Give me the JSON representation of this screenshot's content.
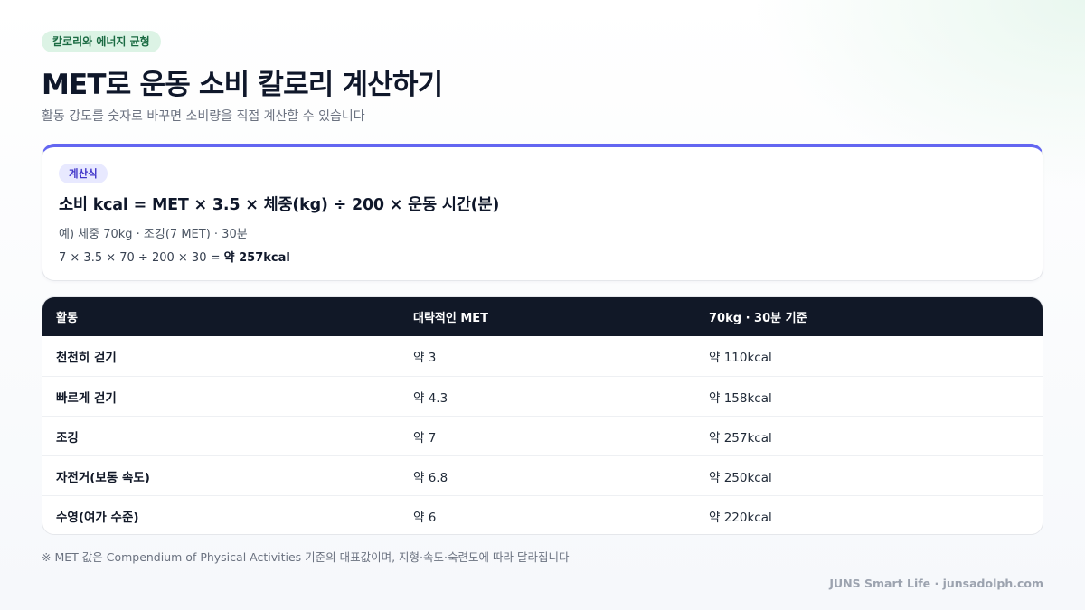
{
  "tag": "칼로리와 에너지 균형",
  "title": "MET로 운동 소비 칼로리 계산하기",
  "subtitle": "활동 강도를 숫자로 바꾸면 소비량을 직접 계산할 수 있습니다",
  "formula_card": {
    "chip": "계산식",
    "formula": "소비 kcal = MET × 3.5 × 체중(kg) ÷ 200 × 운동 시간(분)",
    "example": "예) 체중 70kg · 조깅(7 MET) · 30분",
    "calc_prefix": "7 × 3.5 × 70 ÷ 200 × 30 = ",
    "calc_result": "약 257kcal"
  },
  "table": {
    "headers": [
      "활동",
      "대략적인 MET",
      "70kg · 30분 기준"
    ],
    "rows": [
      [
        "천천히 걷기",
        "약 3",
        "약 110kcal"
      ],
      [
        "빠르게 걷기",
        "약 4.3",
        "약 158kcal"
      ],
      [
        "조깅",
        "약 7",
        "약 257kcal"
      ],
      [
        "자전거(보통 속도)",
        "약 6.8",
        "약 250kcal"
      ],
      [
        "수영(여가 수준)",
        "약 6",
        "약 220kcal"
      ]
    ]
  },
  "footnote": "※ MET 값은 Compendium of Physical Activities 기준의 대표값이며, 지형·속도·숙련도에 따라 달라집니다",
  "brand": "JUNS Smart Life · junsadolph.com",
  "colors": {
    "accent": "#6366f1",
    "header_bg": "#111827",
    "tag_bg": "#dcf3e5",
    "tag_text": "#1b6b43",
    "chip_bg": "#e8e9ff",
    "chip_text": "#4338ca"
  }
}
